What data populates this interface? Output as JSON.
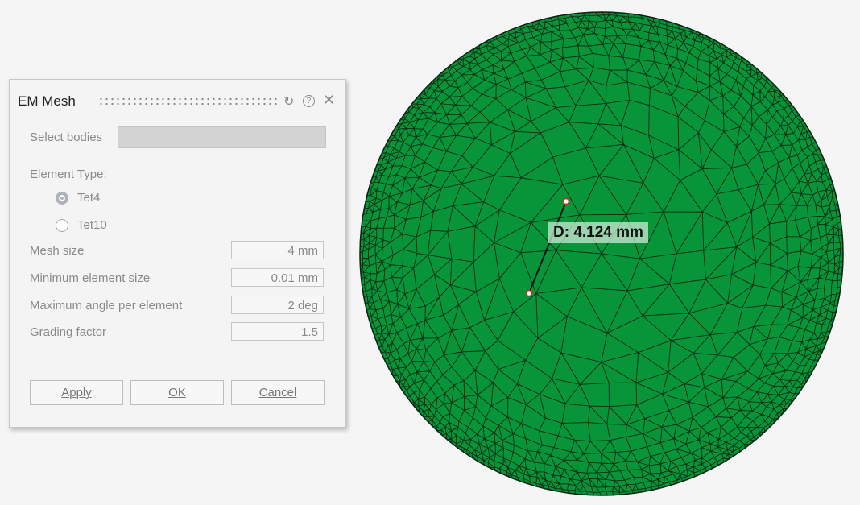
{
  "dialog": {
    "title": "EM Mesh",
    "icons": [
      "reset-icon",
      "help-icon",
      "close-icon"
    ],
    "select_bodies_label": "Select bodies",
    "select_bodies_value": "",
    "element_type_label": "Element Type:",
    "options": [
      {
        "label": "Tet4",
        "selected": true
      },
      {
        "label": "Tet10",
        "selected": false
      }
    ],
    "fields": [
      {
        "label": "Mesh size",
        "value": "4 mm"
      },
      {
        "label": "Minimum element size",
        "value": "0.01 mm"
      },
      {
        "label": "Maximum angle per element",
        "value": "2 deg"
      },
      {
        "label": "Grading factor",
        "value": "1.5"
      }
    ],
    "buttons": {
      "apply": "Apply",
      "ok": "OK",
      "cancel": "Cancel"
    }
  },
  "viewport": {
    "measurement": "D: 4.124 mm",
    "mesh_color": "#08953a"
  }
}
